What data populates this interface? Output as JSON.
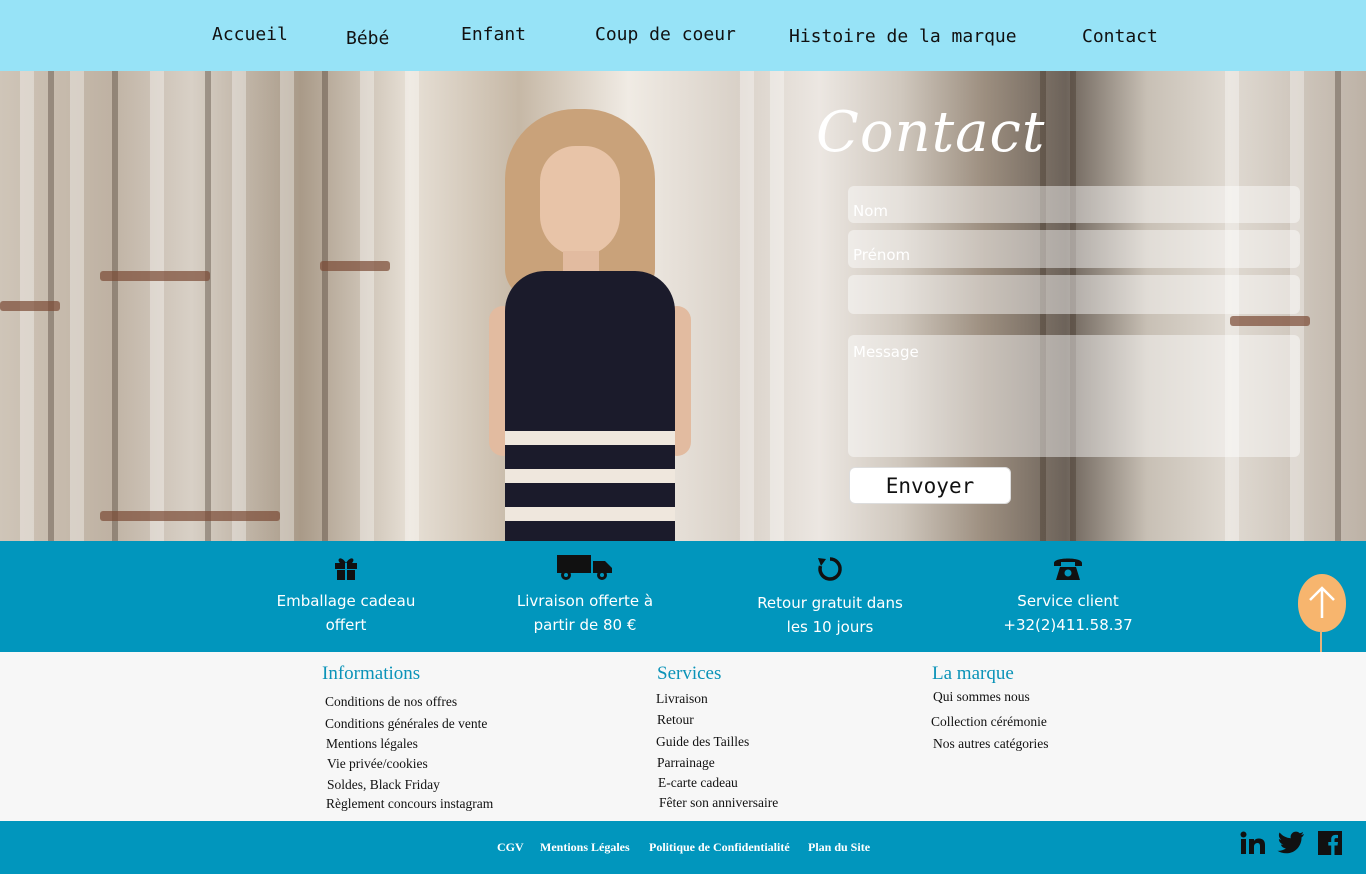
{
  "nav": {
    "items": [
      {
        "label": "Accueil"
      },
      {
        "label": "Bébé"
      },
      {
        "label": "Enfant"
      },
      {
        "label": "Coup de coeur"
      },
      {
        "label": "Histoire de la marque"
      },
      {
        "label": "Contact"
      }
    ]
  },
  "contact": {
    "title": "Contact",
    "fields": {
      "nom": {
        "placeholder": "Nom",
        "value": ""
      },
      "prenom": {
        "placeholder": "Prénom",
        "value": ""
      },
      "extra": {
        "placeholder": "",
        "value": ""
      },
      "message": {
        "placeholder": "Message",
        "value": ""
      }
    },
    "submit_label": "Envoyer"
  },
  "features": [
    {
      "icon": "gift-icon",
      "line1": "Emballage cadeau",
      "line2": "offert"
    },
    {
      "icon": "truck-icon",
      "line1": "Livraison offerte à",
      "line2": "partir de 80 €"
    },
    {
      "icon": "refresh-icon",
      "line1": "Retour gratuit dans",
      "line2": "les 10 jours"
    },
    {
      "icon": "phone-icon",
      "line1": "Service client",
      "line2": "+32(2)411.58.37"
    }
  ],
  "scroll_top": {
    "icon": "arrow-up-icon",
    "color": "#f7b56e"
  },
  "footer": {
    "informations": {
      "title": "Informations",
      "links": [
        "Conditions de nos offres",
        "Conditions générales de vente",
        "Mentions légales",
        "Vie privée/cookies",
        "Soldes, Black Friday",
        "Règlement concours instagram"
      ]
    },
    "services": {
      "title": "Services",
      "links": [
        "Livraison",
        "Retour",
        "Guide des Tailles",
        "Parrainage",
        "E-carte cadeau",
        "Fêter son anniversaire"
      ]
    },
    "marque": {
      "title": "La marque",
      "links": [
        "Qui sommes nous",
        "Collection cérémonie",
        "Nos autres catégories"
      ]
    }
  },
  "bottom_bar": {
    "links": [
      "CGV",
      "Mentions Légales",
      "Politique de Confidentialité",
      "Plan du Site"
    ],
    "social": [
      "linkedin-icon",
      "twitter-icon",
      "facebook-icon"
    ]
  },
  "colors": {
    "nav_bg": "#97e3f7",
    "accent": "#0196bd",
    "title_teal": "#0b93b8"
  }
}
